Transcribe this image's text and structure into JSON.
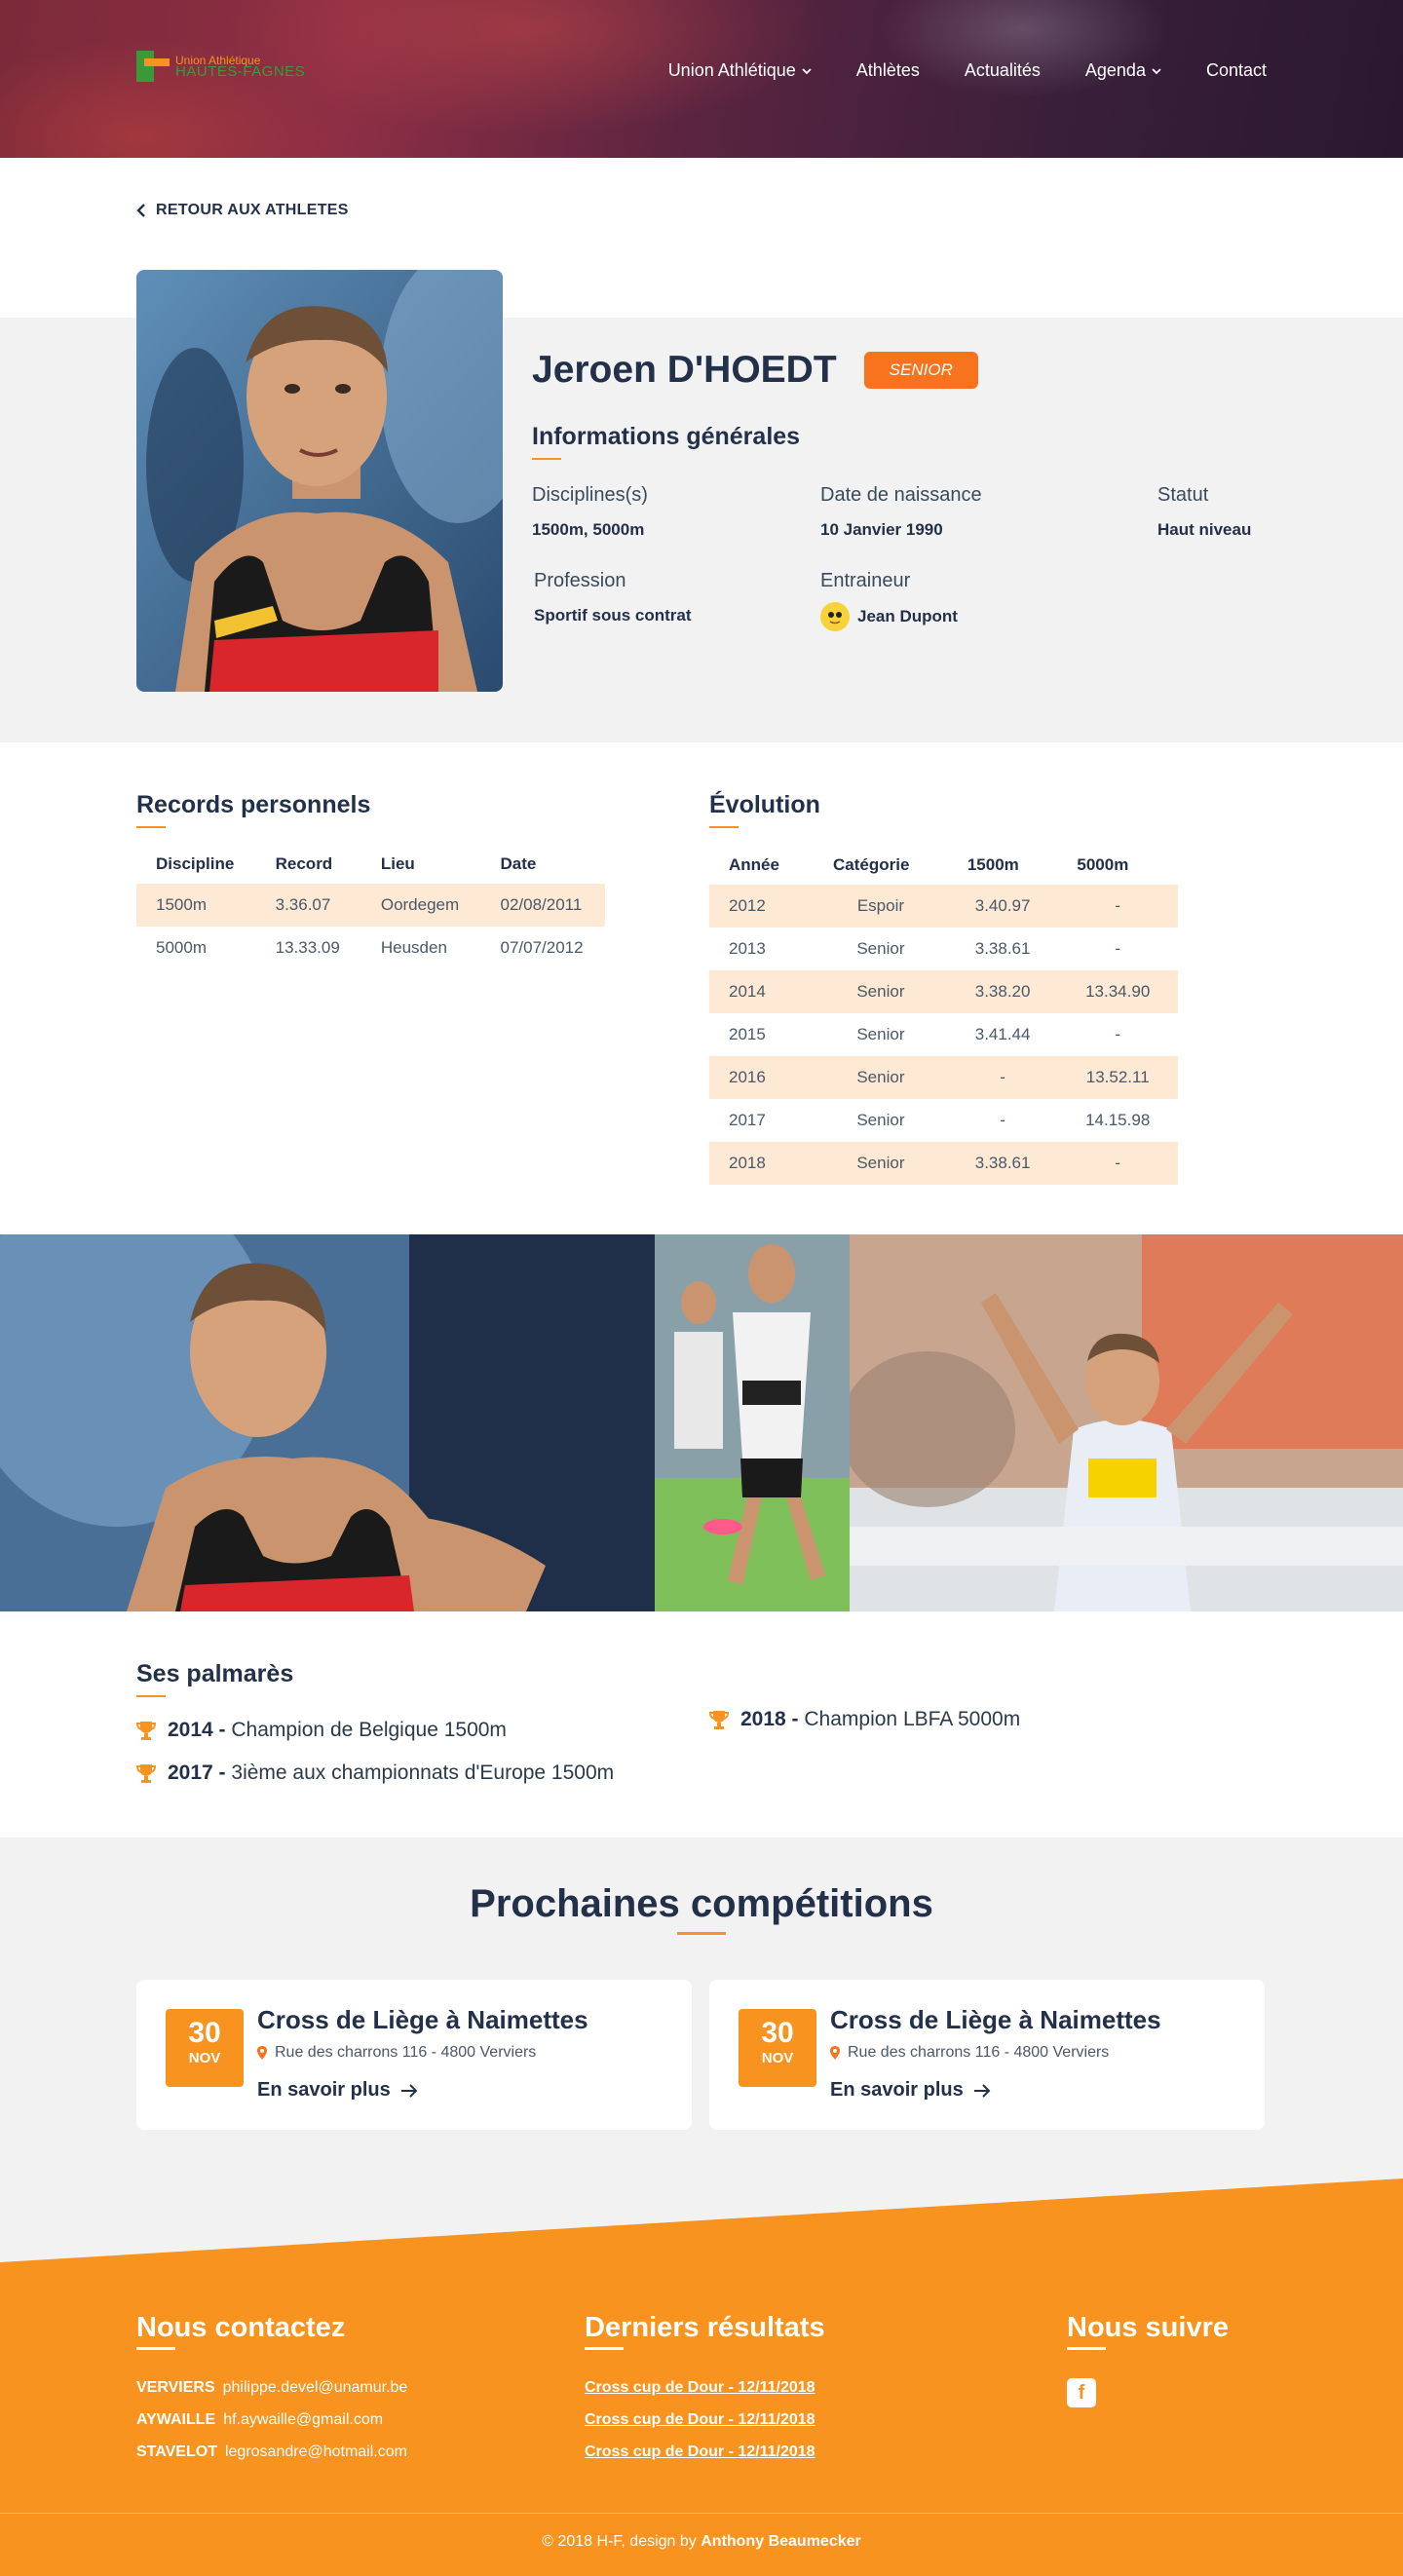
{
  "header": {
    "logo_line1": "Union Athlétique",
    "logo_line2": "HAUTES-FAGNES",
    "nav": [
      "Union Athlétique",
      "Athlètes",
      "Actualités",
      "Agenda",
      "Contact"
    ]
  },
  "back_label": "RETOUR AUX ATHLETES",
  "athlete": {
    "name": "Jeroen D'HOEDT",
    "badge": "SENIOR",
    "info_title": "Informations générales",
    "disciplines_label": "Disciplines(s)",
    "disciplines": "1500m, 5000m",
    "birth_label": "Date de naissance",
    "birth": "10 Janvier 1990",
    "status_label": "Statut",
    "status": "Haut niveau",
    "profession_label": "Profession",
    "profession": "Sportif sous contrat",
    "coach_label": "Entraineur",
    "coach": "Jean Dupont"
  },
  "records": {
    "title": "Records personnels",
    "headers": [
      "Discipline",
      "Record",
      "Lieu",
      "Date"
    ],
    "rows": [
      [
        "1500m",
        "3.36.07",
        "Oordegem",
        "02/08/2011"
      ],
      [
        "5000m",
        "13.33.09",
        "Heusden",
        "07/07/2012"
      ]
    ]
  },
  "evolution": {
    "title": "Évolution",
    "headers": [
      "Année",
      "Catégorie",
      "1500m",
      "5000m"
    ],
    "rows": [
      [
        "2012",
        "Espoir",
        "3.40.97",
        "-"
      ],
      [
        "2013",
        "Senior",
        "3.38.61",
        "-"
      ],
      [
        "2014",
        "Senior",
        "3.38.20",
        "13.34.90"
      ],
      [
        "2015",
        "Senior",
        "3.41.44",
        "-"
      ],
      [
        "2016",
        "Senior",
        "-",
        "13.52.11"
      ],
      [
        "2017",
        "Senior",
        "-",
        "14.15.98"
      ],
      [
        "2018",
        "Senior",
        "3.38.61",
        "-"
      ]
    ]
  },
  "palmares": {
    "title": "Ses palmarès",
    "items": [
      {
        "year": "2014 -",
        "text": "Champion de Belgique 1500m"
      },
      {
        "year": "2017 -",
        "text": "3ième aux championnats d'Europe 1500m"
      },
      {
        "year": "2018 -",
        "text": "Champion LBFA 5000m"
      }
    ]
  },
  "competitions": {
    "title": "Prochaines compétitions",
    "cards": [
      {
        "day": "30",
        "month": "NOV",
        "title": "Cross de Liège à Naimettes",
        "address": "Rue des charrons 116 - 4800 Verviers",
        "more": "En savoir plus"
      },
      {
        "day": "30",
        "month": "NOV",
        "title": "Cross de Liège à Naimettes",
        "address": "Rue des charrons 116 - 4800 Verviers",
        "more": "En savoir plus"
      }
    ]
  },
  "footer": {
    "contact_title": "Nous contactez",
    "contacts": [
      {
        "city": "VERVIERS",
        "email": "philippe.devel@unamur.be"
      },
      {
        "city": "AYWAILLE",
        "email": "hf.aywaille@gmail.com"
      },
      {
        "city": "STAVELOT",
        "email": "legrosandre@hotmail.com"
      }
    ],
    "results_title": "Derniers résultats",
    "results": [
      "Cross cup de Dour - 12/11/2018",
      "Cross cup de Dour - 12/11/2018",
      "Cross cup de Dour - 12/11/2018"
    ],
    "follow_title": "Nous suivre",
    "facebook_glyph": "f",
    "copyright": "© 2018 H-F, design by",
    "designer": "Anthony Beaumecker"
  },
  "colors": {
    "accent": "#f7931e",
    "badge": "#f7731e",
    "navy": "#22304a",
    "row_highlight": "#fde9d4"
  }
}
